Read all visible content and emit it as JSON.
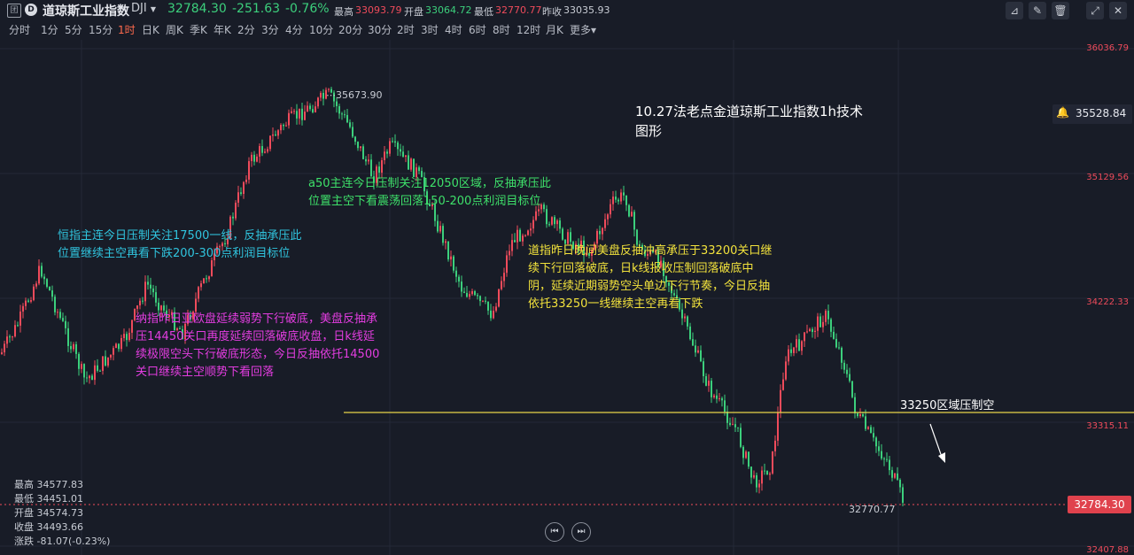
{
  "header": {
    "logo_text": "团",
    "symbol_name": "道琼斯工业指数",
    "symbol_code": "DJI",
    "last_price": "32784.30",
    "change": "-251.63",
    "change_pct": "-0.76%",
    "high_label": "最高",
    "high_value": "33093.79",
    "open_label": "开盘",
    "open_value": "33064.72",
    "low_label": "最低",
    "low_value": "32770.77",
    "prev_close_label": "昨收",
    "prev_close_value": "33035.93"
  },
  "toolbar_icons": [
    "indicator-icon",
    "draw-icon",
    "delete-icon",
    "fullscreen-icon",
    "close-icon"
  ],
  "timeframes": [
    "分时",
    "1分",
    "5分",
    "15分",
    "1时",
    "日K",
    "周K",
    "季K",
    "年K",
    "2分",
    "3分",
    "4分",
    "10分",
    "20分",
    "30分",
    "2时",
    "3时",
    "4时",
    "6时",
    "8时",
    "12时",
    "月K",
    "更多"
  ],
  "active_timeframe": "1时",
  "price_axis": {
    "labels": [
      "36036.79",
      "35129.56",
      "34222.33",
      "33315.11",
      "32407.88"
    ],
    "crosshair_value": "35528.84",
    "last_price_tag": "32784.30"
  },
  "chart_marks": {
    "high_mark": "35673.90",
    "low_mark": "32770.77"
  },
  "annotations": {
    "title_line1": "10.27法老点金道琼斯工业指数1h技术",
    "title_line2": "图形",
    "hs_line1": "恒指主连今日压制关注17500一线，反抽承压此",
    "hs_line2": "位置继续主空再看下跌200-300点利润目标位",
    "a50_line1": "a50主连今日压制关注12050区域，反抽承压此",
    "a50_line2": "位置主空下看震荡回落150-200点利润目标位",
    "nas_line1": "纳指昨日亚欧盘延续弱势下行破底，美盘反抽承",
    "nas_line2": "压14450关口再度延续回落破底收盘，日k线延",
    "nas_line3": "续极限空头下行破底形态，今日反抽依托14500",
    "nas_line4": "关口继续主空顺势下看回落",
    "dow_line1": "道指昨日晚间美盘反抽冲高承压于33200关口继",
    "dow_line2": "续下行回落破底，日k线报收压制回落破底中",
    "dow_line3": "阴，延续近期弱势空头单边下行节奏，今日反抽",
    "dow_line4": "依托33250一线继续主空再看下跌",
    "resistance": "33250区域压制空"
  },
  "ohlc_panel": {
    "high": "最高 34577.83",
    "low": "最低 34451.01",
    "open": "开盘 34574.73",
    "close": "收盘 34493.66",
    "change": "涨跌 -81.07(-0.23%)"
  },
  "colors": {
    "background": "#181c27",
    "up": "#ef4b5b",
    "down": "#3ccf7c",
    "resistance_line": "#e8d44a",
    "ann_cyan": "#30c4de",
    "ann_green": "#3ee06a",
    "ann_magenta": "#e33de0",
    "ann_yellow": "#f2e23c"
  }
}
